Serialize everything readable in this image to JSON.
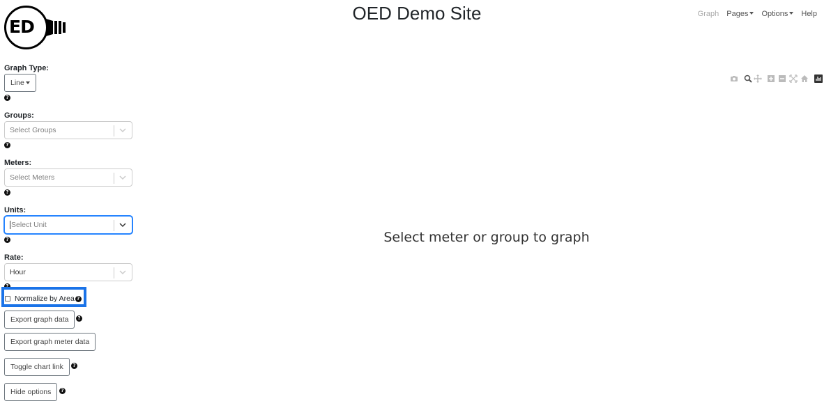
{
  "header": {
    "title": "OED Demo Site",
    "logo_text": "ED",
    "nav": [
      {
        "label": "Graph",
        "dropdown": false,
        "disabled": true
      },
      {
        "label": "Pages",
        "dropdown": true,
        "disabled": false
      },
      {
        "label": "Options",
        "dropdown": true,
        "disabled": false
      },
      {
        "label": "Help",
        "dropdown": false,
        "disabled": false
      }
    ]
  },
  "sidebar": {
    "graph_type": {
      "label": "Graph Type:",
      "value": "Line"
    },
    "groups": {
      "label": "Groups:",
      "placeholder": "Select Groups"
    },
    "meters": {
      "label": "Meters:",
      "placeholder": "Select Meters"
    },
    "units": {
      "label": "Units:",
      "placeholder": "Select Unit",
      "focused": true
    },
    "rate": {
      "label": "Rate:",
      "value": "Hour"
    },
    "normalize": {
      "label": "Normalize by Area",
      "checked": false
    },
    "buttons": {
      "export_data": "Export graph data",
      "export_meter_data": "Export graph meter data",
      "toggle_chart_link": "Toggle chart link",
      "hide_options": "Hide options"
    },
    "help_glyph": "?"
  },
  "main": {
    "message": "Select meter or group to graph",
    "toolbar_icons": [
      "camera-icon",
      "zoom-icon",
      "pan-icon",
      "zoom-in-icon",
      "zoom-out-icon",
      "autoscale-icon",
      "reset-axes-icon",
      "plotly-logo-icon"
    ]
  },
  "colors": {
    "highlight": "#1a73e8",
    "focus_border": "#2684ff"
  }
}
